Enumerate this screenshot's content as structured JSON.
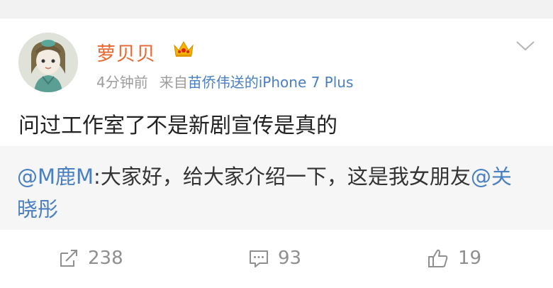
{
  "post": {
    "username": "萝贝贝",
    "badge_icon": "crown-icon",
    "meta": {
      "time": "4分钟前",
      "source_prefix": "来自",
      "source_link": "苗侨伟送的iPhone 7 Plus"
    },
    "text": "问过工作室了不是新剧宣传是真的"
  },
  "repost": {
    "author_mention": "@M鹿M",
    "text": ":大家好，给大家介绍一下，这是我女朋友",
    "tag_mention": "@关晓彤"
  },
  "actions": {
    "repost_count": "238",
    "comment_count": "93",
    "like_count": "19"
  },
  "colors": {
    "username": "#e8672f",
    "link": "#4a7fc1",
    "muted": "#9c9c9c",
    "repost_bg": "#f6f6f6"
  }
}
